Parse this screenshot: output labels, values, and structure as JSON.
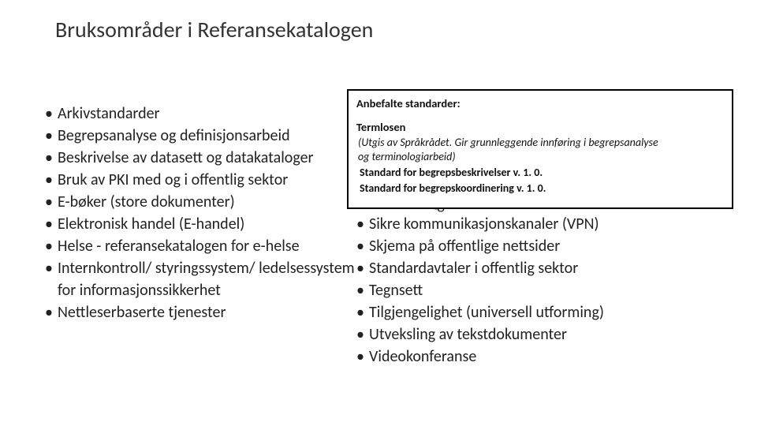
{
  "title": "Bruksområder i Referansekatalogen",
  "leftItems": [
    "Arkivstandarder",
    "Begrepsanalyse og definisjonsarbeid",
    "Beskrivelse av datasett og datakataloger",
    "Bruk av PKI med og i offentlig sektor",
    "E-bøker (store dokumenter)",
    "Elektronisk handel (E-handel)",
    "Helse - referansekatalogen for e-helse",
    "Internkontroll/ styringssystem/ ledelsessystem for informasjons­sikkerhet",
    "Nettleserbaserte tjenester"
  ],
  "rightItems": [
    "Publisering av tekstdokumenter",
    "Sikre kommunikasjonskanaler (VPN)",
    "Skjema på offentlige nettsider",
    "Standardavtaler i offentlig sektor",
    "Tegnsett",
    "Tilgjengelighet (universell utforming)",
    "Utveksling av tekstdokumenter",
    "Videokonferanse"
  ],
  "partialVisible": "Publisering av tekstdokumenter",
  "overlay": {
    "heading": "Anbefalte standarder:",
    "term": "Termlosen",
    "italic1": "(Utgis av Språkrådet. Gir grunnleggende innføring i begrepsanalyse",
    "italic2": " og terminologiarbeid)",
    "std1": "Standard for begrepsbeskrivelser v. 1. 0.",
    "std2": "Standard for begrepskoordinering v. 1. 0."
  }
}
